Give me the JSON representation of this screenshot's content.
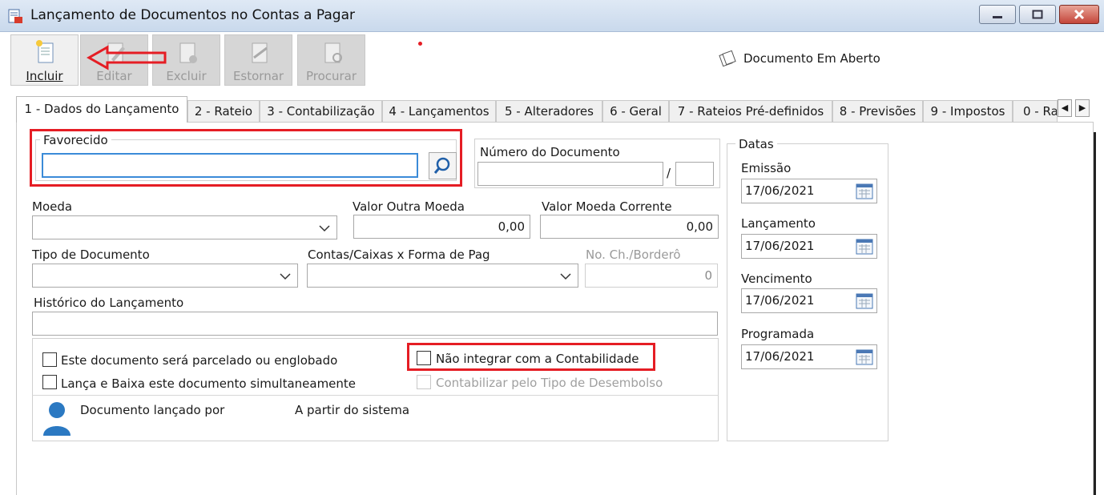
{
  "window": {
    "title": "Lançamento de Documentos no Contas a Pagar"
  },
  "toolbar": {
    "buttons": [
      {
        "label": "Incluir",
        "enabled": true,
        "icon": "new-document-icon"
      },
      {
        "label": "Editar",
        "enabled": false,
        "icon": "edit-document-icon"
      },
      {
        "label": "Excluir",
        "enabled": false,
        "icon": "delete-document-icon"
      },
      {
        "label": "Estornar",
        "enabled": false,
        "icon": "reverse-document-icon"
      },
      {
        "label": "Procurar",
        "enabled": false,
        "icon": "search-document-icon"
      }
    ],
    "status_text": "Documento Em Aberto"
  },
  "tabs": [
    {
      "label": "1 - Dados do Lançamento",
      "active": true
    },
    {
      "label": "2 - Rateio"
    },
    {
      "label": "3 - Contabilização"
    },
    {
      "label": "4 - Lançamentos"
    },
    {
      "label": "5 - Alteradores"
    },
    {
      "label": "6 - Geral"
    },
    {
      "label": "7 - Rateios Pré-definidos"
    },
    {
      "label": "8 - Previsões"
    },
    {
      "label": "9 - Impostos"
    },
    {
      "label": "0 - Ra"
    }
  ],
  "form": {
    "favorecido": {
      "label": "Favorecido",
      "value": ""
    },
    "numero_documento": {
      "label": "Número do Documento",
      "value": "",
      "separator": "/",
      "suffix": ""
    },
    "moeda": {
      "label": "Moeda",
      "value": ""
    },
    "valor_outra_moeda": {
      "label": "Valor Outra Moeda",
      "value": "0,00"
    },
    "valor_moeda_corrente": {
      "label": "Valor Moeda Corrente",
      "value": "0,00"
    },
    "tipo_documento": {
      "label": "Tipo de Documento",
      "value": ""
    },
    "contas_caixas": {
      "label": "Contas/Caixas x Forma de Pag",
      "value": ""
    },
    "no_ch_bordero": {
      "label": "No. Ch./Borderô",
      "value": "0"
    },
    "historico": {
      "label": "Histórico do Lançamento",
      "value": ""
    },
    "checks": {
      "parcelado": {
        "label": "Este documento será parcelado ou englobado",
        "checked": false
      },
      "lanca_baixa": {
        "label": "Lança e Baixa este documento simultaneamente",
        "checked": false
      },
      "nao_integrar": {
        "label": "Não integrar com a Contabilidade",
        "checked": false
      },
      "contabilizar_tipo": {
        "label": "Contabilizar pelo Tipo de Desembolso",
        "checked": false,
        "enabled": false
      }
    },
    "lancado_por": {
      "label": "Documento lançado por",
      "value": "A partir do sistema"
    }
  },
  "datas": {
    "legend": "Datas",
    "emissao": {
      "label": "Emissão",
      "value": "17/06/2021"
    },
    "lancamento": {
      "label": "Lançamento",
      "value": "17/06/2021"
    },
    "vencimento": {
      "label": "Vencimento",
      "value": "17/06/2021"
    },
    "programada": {
      "label": "Programada",
      "value": "17/06/2021"
    }
  },
  "colors": {
    "highlight_red": "#e51d24",
    "user_icon_blue": "#2b79c2",
    "focus_blue": "#3b8bd8"
  }
}
